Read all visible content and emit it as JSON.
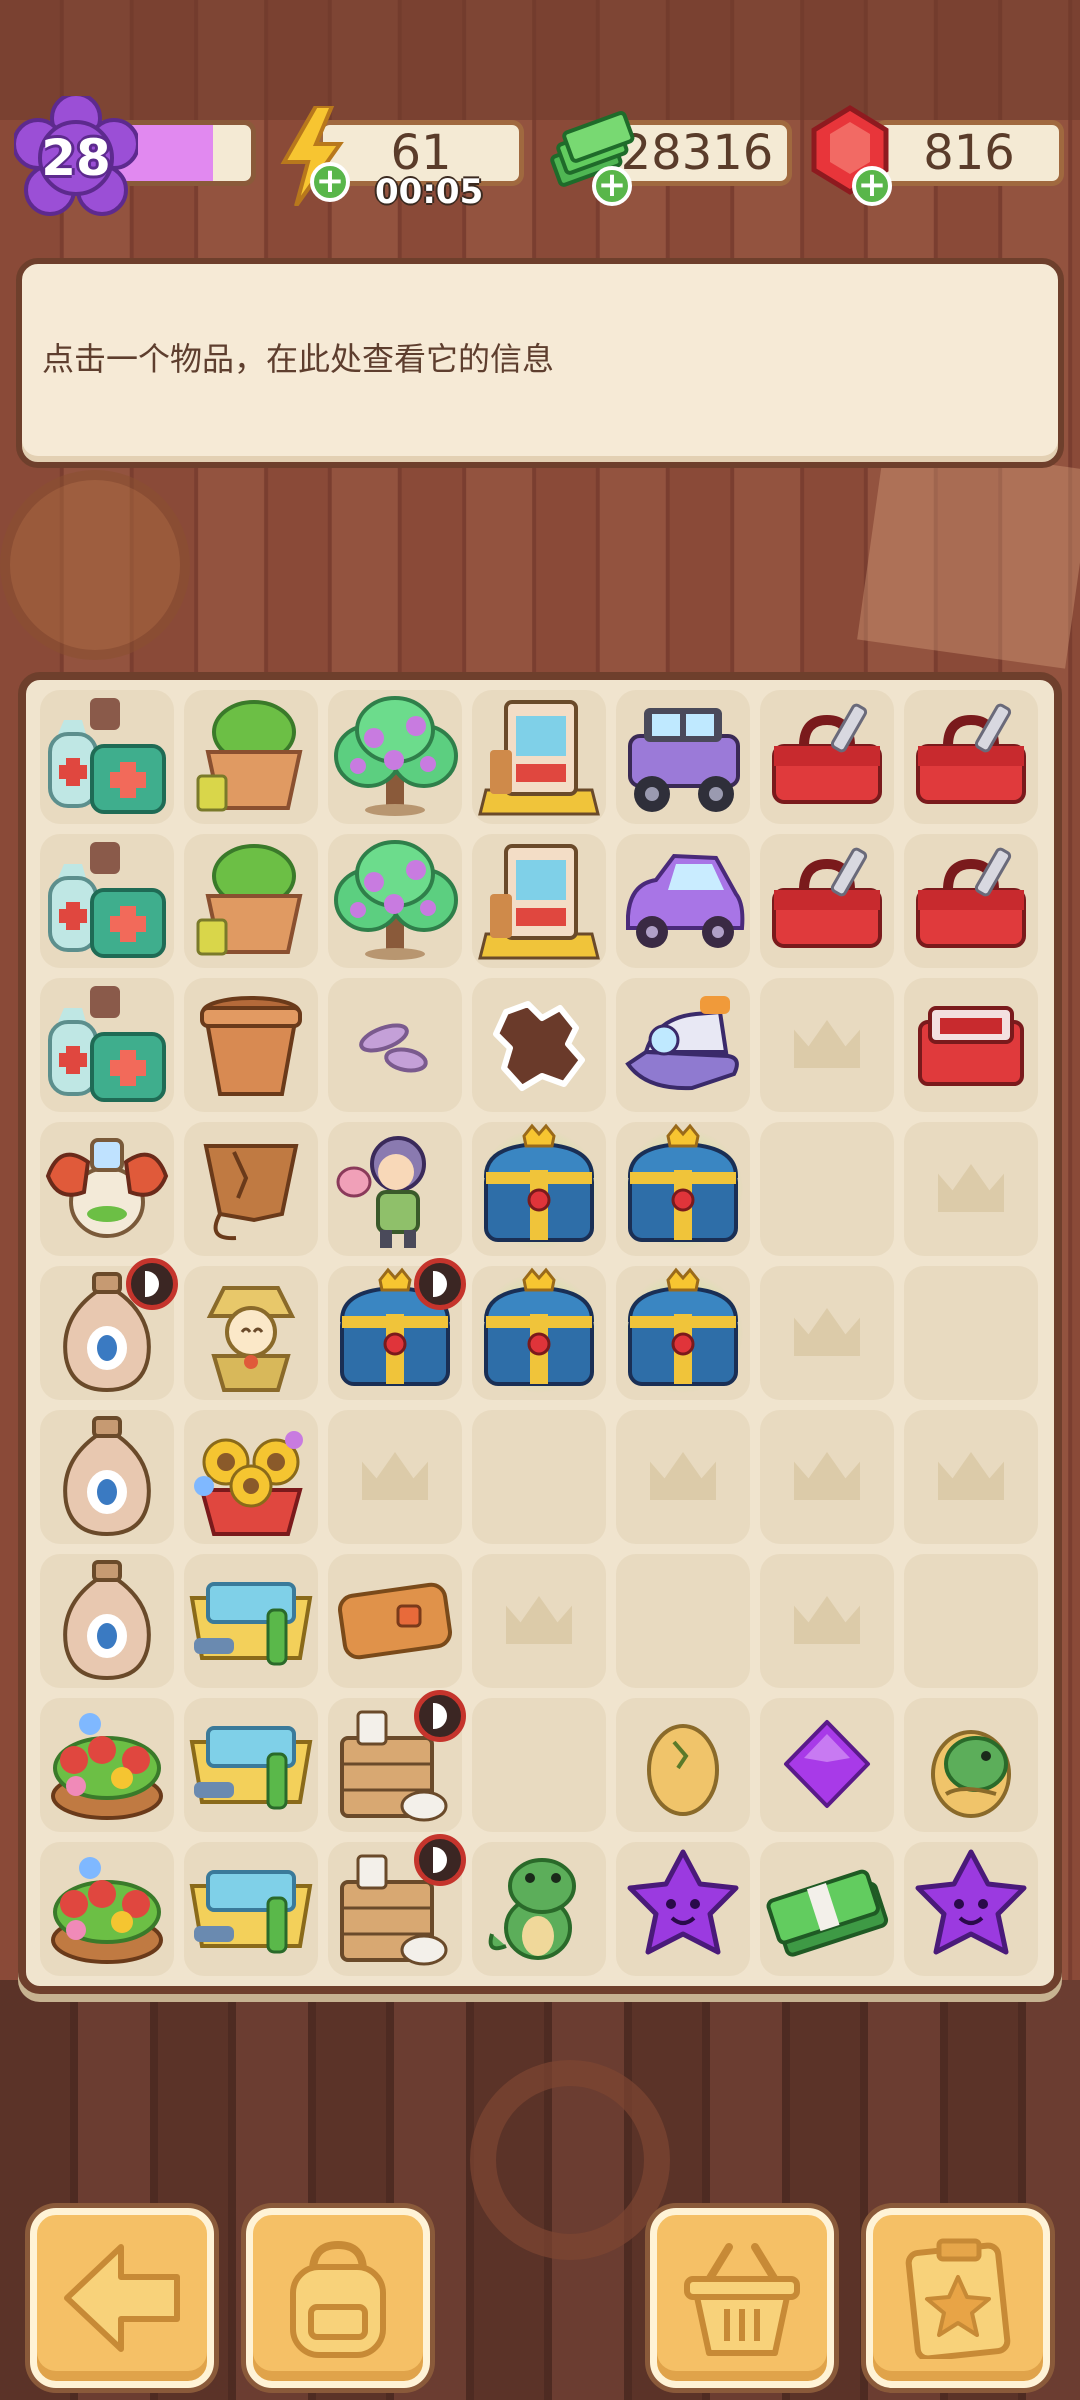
{
  "hud": {
    "level": "28",
    "level_progress": 0.72,
    "energy": "61",
    "energy_timer": "00:05",
    "cash": "28316",
    "gems": "816"
  },
  "info_panel": {
    "text": "点击一个物品，在此处查看它的信息"
  },
  "board": {
    "columns": 7,
    "rows": 9,
    "cells": [
      [
        "medical-kit-icon",
        "plant-pot-icon",
        "flower-tree-icon",
        "vending-machine-icon",
        "jeep-icon",
        "toolbox-icon",
        "toolbox-icon"
      ],
      [
        "medical-kit-icon",
        "plant-pot-icon",
        "flower-tree-icon",
        "vending-machine-icon",
        "car-icon",
        "toolbox-icon",
        "toolbox-icon"
      ],
      [
        "medical-kit-icon",
        "empty-pot-icon",
        "pebbles-icon",
        "cookie-icon",
        "jetski-icon",
        "empty",
        "red-box-icon"
      ],
      [
        "dragon-vase-icon",
        "broken-pot-icon",
        "character-icon",
        "treasure-chest-icon",
        "treasure-chest-icon",
        "plain",
        "empty"
      ],
      [
        "vase-icon",
        "scarecrow-icon",
        "treasure-chest-icon",
        "treasure-chest-icon",
        "treasure-chest-icon",
        "empty",
        "plain"
      ],
      [
        "vase-icon",
        "sunflower-basket-icon",
        "empty",
        "plain",
        "empty",
        "empty",
        "empty"
      ],
      [
        "vase-icon",
        "bathtub-icon",
        "wallet-icon",
        "empty",
        "plain",
        "empty",
        "plain"
      ],
      [
        "flower-basket-icon",
        "bathtub-icon",
        "crate-icon",
        "plain",
        "egg-icon",
        "purple-gem-icon",
        "dino-egg-icon"
      ],
      [
        "flower-basket-icon",
        "bathtub-icon",
        "crate-icon",
        "dinosaur-icon",
        "purple-star-icon",
        "cash-icon",
        "purple-star-icon"
      ]
    ]
  },
  "buttons": {
    "back": "back-arrow-icon",
    "bag": "backpack-icon",
    "shop": "basket-icon",
    "tasks": "clipboard-icon"
  },
  "colors": {
    "board_bg": "#f0e4ce",
    "frame": "#6e3f2c",
    "level_badge": "#9b4fd6",
    "button": "#f5c066"
  }
}
